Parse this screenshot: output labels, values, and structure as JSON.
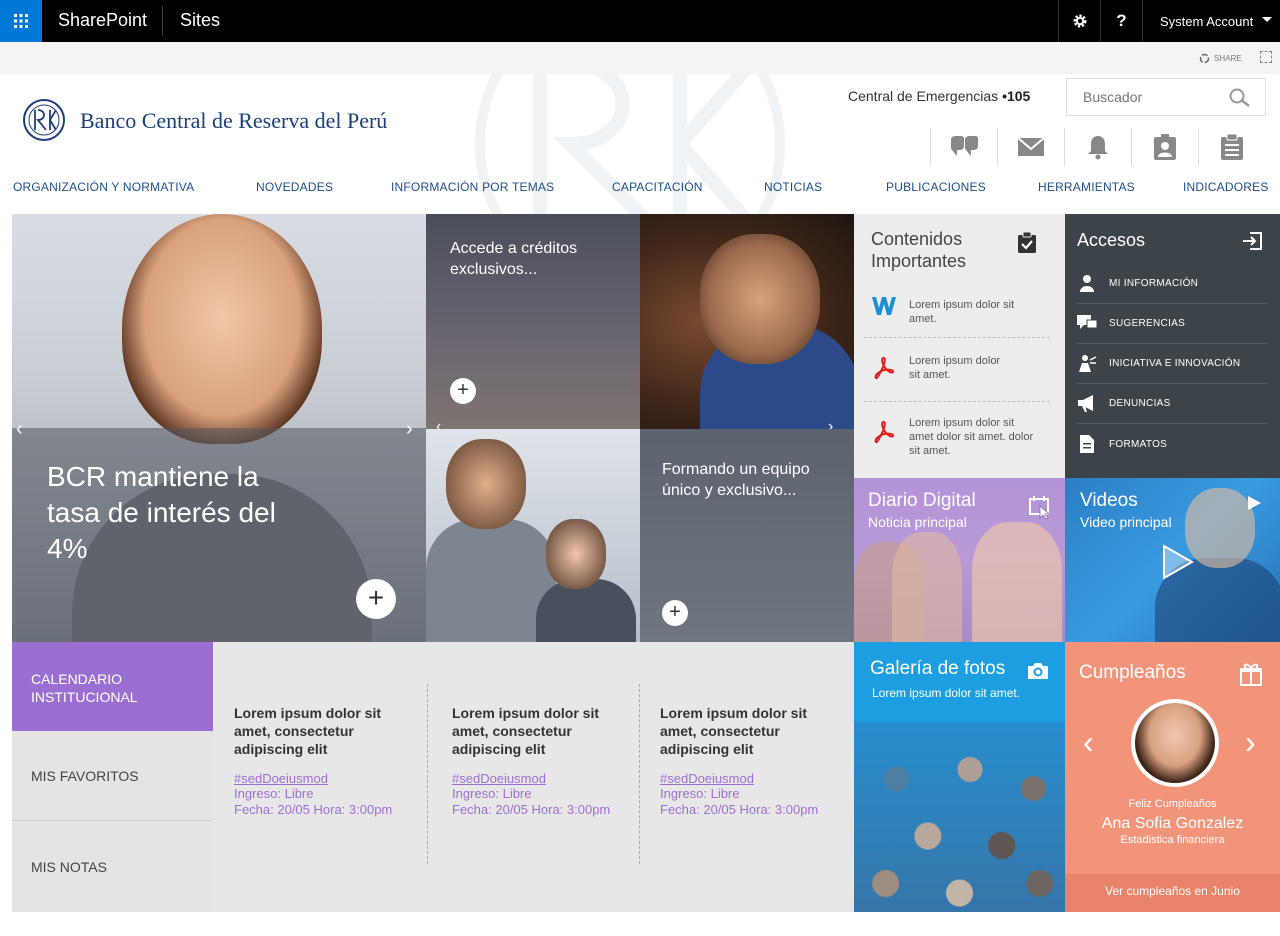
{
  "topbar": {
    "brand": "SharePoint",
    "sites": "Sites",
    "help": "?",
    "account": "System Account",
    "share": "SHARE"
  },
  "header": {
    "bank_name": "Banco Central de Reserva del Perú",
    "emergency_label": "Central de Emergencias",
    "emergency_number": "•105",
    "search_placeholder": "Buscador"
  },
  "nav": [
    "ORGANIZACIÓN Y NORMATIVA",
    "NOVEDADES",
    "INFORMACIÓN POR TEMAS",
    "CAPACITACIÓN",
    "NOTICIAS",
    "PUBLICACIONES",
    "HERRAMIENTAS",
    "INDICADORES"
  ],
  "hero": {
    "headline": "BCR mantiene la tasa de interés del 4%",
    "plus": "+"
  },
  "tiles": {
    "creditos": "Accede a créditos exclusivos...",
    "equipo": "Formando un equipo único y exclusivo...",
    "plus": "+"
  },
  "contenidos": {
    "title": "Contenidos Importantes",
    "items": [
      {
        "icon": "word-icon",
        "label": "Lorem ipsum dolor sit amet."
      },
      {
        "icon": "pdf-icon",
        "label": "Lorem ipsum dolor sit amet."
      },
      {
        "icon": "pdf-icon",
        "label": "Lorem ipsum dolor sit amet dolor sit amet. dolor sit amet."
      }
    ]
  },
  "accesos": {
    "title": "Accesos",
    "items": [
      {
        "icon": "user-info-icon",
        "label": "MI INFORMACIÓN"
      },
      {
        "icon": "chat-icon",
        "label": "SUGERENCIAS"
      },
      {
        "icon": "innovation-icon",
        "label": "INICIATIVA E INNOVACIÓN"
      },
      {
        "icon": "megaphone-icon",
        "label": "DENUNCIAS"
      },
      {
        "icon": "document-icon",
        "label": "FORMATOS"
      }
    ]
  },
  "diario": {
    "title": "Diario Digital",
    "subtitle": "Noticia principal"
  },
  "videos": {
    "title": "Videos",
    "subtitle": "Video principal"
  },
  "calendar_nav": {
    "calendar": "CALENDARIO INSTITUCIONAL",
    "favorites": "MIS FAVORITOS",
    "notes": "MIS NOTAS"
  },
  "events": [
    {
      "title": "Lorem ipsum dolor sit amet, consectetur adipiscing elit",
      "tag": "#sedDoeiusmod",
      "ingreso": "Ingreso: Libre",
      "fecha": "Fecha: 20/05  Hora: 3:00pm"
    },
    {
      "title": "Lorem ipsum dolor sit amet, consectetur adipiscing elit",
      "tag": "#sedDoeiusmod",
      "ingreso": "Ingreso: Libre",
      "fecha": "Fecha: 20/05  Hora: 3:00pm"
    },
    {
      "title": "Lorem ipsum dolor sit amet, consectetur adipiscing elit",
      "tag": "#sedDoeiusmod",
      "ingreso": "Ingreso: Libre",
      "fecha": "Fecha: 20/05  Hora: 3:00pm"
    }
  ],
  "galeria": {
    "title": "Galería de fotos",
    "subtitle": "Lorem ipsum dolor sit amet."
  },
  "cumple": {
    "title": "Cumpleaños",
    "greeting": "Feliz Cumpleaños",
    "name": "Ana Sofia Gonzalez",
    "role": "Estadistica financiera",
    "footer": "Ver cumpleaños en Junio"
  },
  "colors": {
    "accent_purple": "#9b6fd1",
    "nav_blue": "#1d4e89",
    "sharepoint_blue": "#0078d7",
    "cumple": "#f2947a",
    "galeria": "#1c9ee0",
    "accesos": "#3d4449"
  }
}
